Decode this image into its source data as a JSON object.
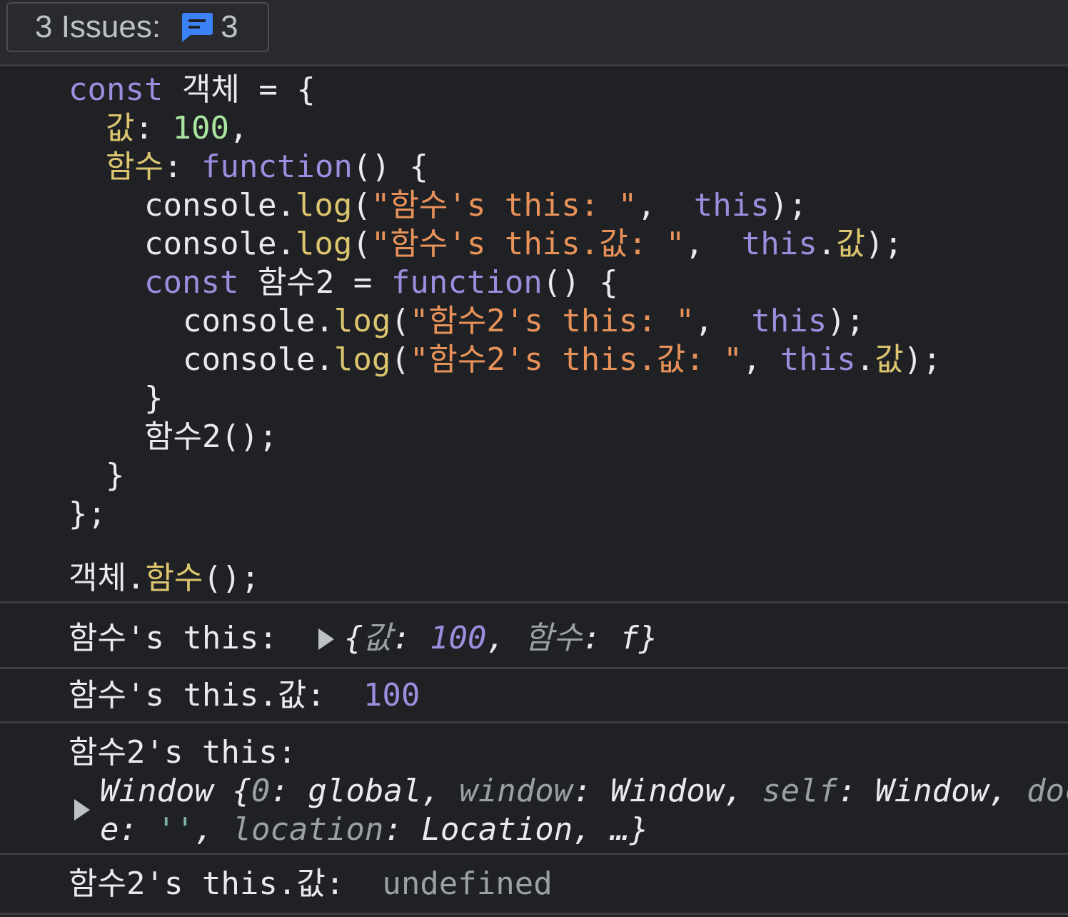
{
  "issues_bar": {
    "label": "3 Issues:",
    "icon": "message-icon",
    "count": "3",
    "icon_color": "#3b82f6"
  },
  "code": {
    "line1": {
      "kw": "const",
      "rest": " 객체 = {"
    },
    "line2": {
      "prop": "값",
      "colon": ": ",
      "num": "100",
      "end": ","
    },
    "line3": {
      "prop": "함수",
      "colon": ": ",
      "kw": "function",
      "end": "() {"
    },
    "line4": {
      "obj": "console.",
      "fn": "log",
      "open": "(",
      "str": "\"함수's this: \"",
      "comma": ",  ",
      "kw": "this",
      "end": ");"
    },
    "line5": {
      "obj": "console.",
      "fn": "log",
      "open": "(",
      "str": "\"함수's this.값: \"",
      "comma": ",  ",
      "kw": "this",
      "dot": ".",
      "prop": "값",
      "end": ");"
    },
    "line6": {
      "kw": "const",
      "mid": " 함수2 = ",
      "kw2": "function",
      "end": "() {"
    },
    "line7": {
      "obj": "console.",
      "fn": "log",
      "open": "(",
      "str": "\"함수2's this: \"",
      "comma": ",  ",
      "kw": "this",
      "end": ");"
    },
    "line8": {
      "obj": "console.",
      "fn": "log",
      "open": "(",
      "str": "\"함수2's this.값: \"",
      "comma": ", ",
      "kw": "this",
      "dot": ".",
      "prop": "값",
      "end": ");"
    },
    "line9": "}",
    "line10": "함수2();",
    "line11": "}",
    "line12": "};",
    "line13": {
      "obj": "객체.",
      "prop": "함수",
      "end": "();"
    }
  },
  "output": {
    "row1": {
      "label": "함수's this:  ",
      "open": "{",
      "key1": "값",
      "sep1": ": ",
      "val1": "100",
      "comma1": ", ",
      "key2": "함수",
      "sep2": ": ",
      "val2": "f",
      "close": "}"
    },
    "row2": {
      "label": "함수's this.값:  ",
      "value": "100"
    },
    "row3": {
      "label": "함수2's this:",
      "l1_a": "Window {",
      "l1_k0": "0",
      "l1_b": ": global, ",
      "l1_k1": "window",
      "l1_c": ": Window, ",
      "l1_k2": "self",
      "l1_d": ": Window, ",
      "l1_k3": "doc",
      "l2_a": "e: ",
      "l2_str": "''",
      "l2_b": ", ",
      "l2_k": "location",
      "l2_c": ": Location, …}"
    },
    "row4": {
      "label": "함수2's this.값:  ",
      "value": "undefined"
    }
  }
}
